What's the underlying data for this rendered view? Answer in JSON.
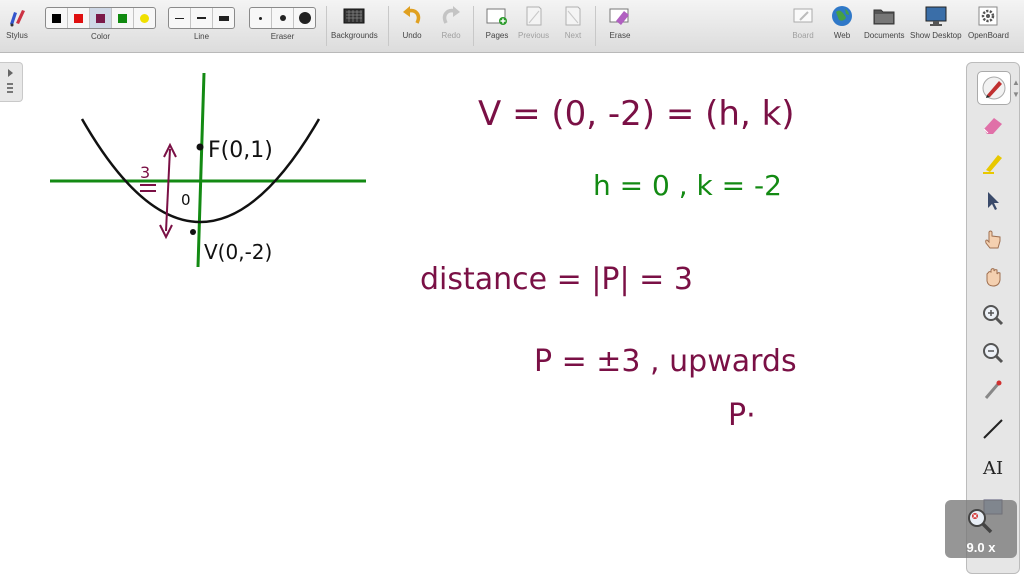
{
  "toolbar": {
    "stylus": "Stylus",
    "color": "Color",
    "line": "Line",
    "eraser": "Eraser",
    "backgrounds": "Backgrounds",
    "undo": "Undo",
    "redo": "Redo",
    "pages": "Pages",
    "previous": "Previous",
    "next": "Next",
    "erase": "Erase",
    "board": "Board",
    "web": "Web",
    "documents": "Documents",
    "show_desktop": "Show Desktop",
    "openboard": "OpenBoard"
  },
  "colors": {
    "swatches": [
      "#000000",
      "#e01010",
      "#7a1a4a",
      "#108a10",
      "#f0e000"
    ],
    "pen_maroon": "#7a1045",
    "pen_green": "#138a13",
    "pen_black": "#111111"
  },
  "board": {
    "focus_label": "F(0,1)",
    "vertex_label": "V(0,-2)",
    "origin_label": "0",
    "distance_mark": "3",
    "line1": "V = (0, -2) = (h, k)",
    "line2": "h = 0 ,  k = -2",
    "line3": "distance = |P| = 3",
    "line4": "P = ±3 ,  upwards",
    "line5": "P·"
  },
  "zoom": {
    "level": "9.0 x"
  }
}
